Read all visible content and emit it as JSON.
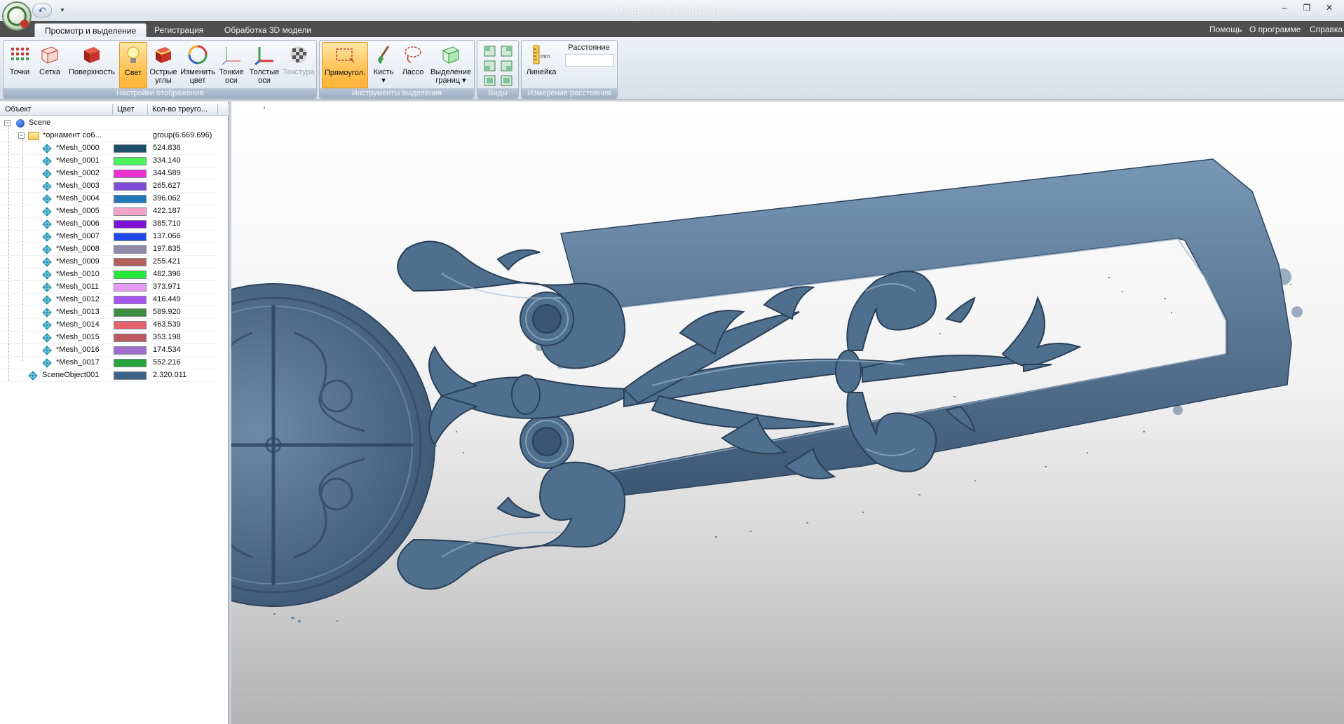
{
  "app": {
    "title": "RangeVision ScanMerge"
  },
  "quick_access": {
    "undo_glyph": "↶",
    "dropdown_glyph": "▾"
  },
  "window": {
    "minimize": "–",
    "restore": "❐",
    "close": "✕"
  },
  "tabs": [
    {
      "label": "Просмотр и выделение",
      "active": true
    },
    {
      "label": "Регистрация",
      "active": false
    },
    {
      "label": "Обработка 3D модели",
      "active": false
    }
  ],
  "help_links": [
    "Помощь",
    "О программе",
    "Справка"
  ],
  "ribbon": {
    "groups": [
      {
        "label": "Настройки отображения"
      },
      {
        "label": "Инструменты выделения"
      },
      {
        "label": "Виды"
      },
      {
        "label": "Измерение расстояния"
      }
    ],
    "display": {
      "points": "Точки",
      "grid": "Сетка",
      "surface": "Поверхность",
      "light": "Свет",
      "sharp_angles": [
        "Острые",
        "углы"
      ],
      "change_color": [
        "Изменить",
        "цвет"
      ],
      "thin_axes": [
        "Тонкие",
        "оси"
      ],
      "thick_axes": [
        "Толстые",
        "оси"
      ],
      "texture": "Текстура"
    },
    "selection": {
      "rectangle": "Прямоугол.",
      "brush": "Кисть",
      "lasso": "Лассо",
      "boundary": [
        "Выделение",
        "границ"
      ]
    },
    "measure": {
      "ruler": "Линейка",
      "ruler_unit": "mm",
      "distance_label": "Расстояние",
      "distance_value": ""
    }
  },
  "tree": {
    "headers": {
      "object": "Объект",
      "color": "Цвет",
      "triangles": "Кол-во треуго..."
    },
    "scene": "Scene",
    "group": {
      "name": "*орнамент соб...",
      "count": "group(6.669.696)"
    },
    "meshes": [
      {
        "name": "*Mesh_0000",
        "color": "#1d4f66",
        "count": "524.836"
      },
      {
        "name": "*Mesh_0001",
        "color": "#4bf25c",
        "count": "334.140"
      },
      {
        "name": "*Mesh_0002",
        "color": "#ee2fd2",
        "count": "344.589"
      },
      {
        "name": "*Mesh_0003",
        "color": "#7e4bd6",
        "count": "265.627"
      },
      {
        "name": "*Mesh_0004",
        "color": "#1f78b8",
        "count": "396.062"
      },
      {
        "name": "*Mesh_0005",
        "color": "#f3a4c6",
        "count": "422.187"
      },
      {
        "name": "*Mesh_0006",
        "color": "#7d10d4",
        "count": "385.710"
      },
      {
        "name": "*Mesh_0007",
        "color": "#1f49e8",
        "count": "137.066"
      },
      {
        "name": "*Mesh_0008",
        "color": "#8f8aa8",
        "count": "197.835"
      },
      {
        "name": "*Mesh_0009",
        "color": "#b5605c",
        "count": "255.421"
      },
      {
        "name": "*Mesh_0010",
        "color": "#25e83a",
        "count": "482.396"
      },
      {
        "name": "*Mesh_0011",
        "color": "#e79af1",
        "count": "373.971"
      },
      {
        "name": "*Mesh_0012",
        "color": "#a856ee",
        "count": "416.449"
      },
      {
        "name": "*Mesh_0013",
        "color": "#3a8e3e",
        "count": "589.920"
      },
      {
        "name": "*Mesh_0014",
        "color": "#e8626a",
        "count": "463.539"
      },
      {
        "name": "*Mesh_0015",
        "color": "#bd5a5f",
        "count": "353.198"
      },
      {
        "name": "*Mesh_0016",
        "color": "#a36ccf",
        "count": "174.534"
      },
      {
        "name": "*Mesh_0017",
        "color": "#29a63b",
        "count": "552.216"
      }
    ],
    "scene_object": {
      "name": "SceneObject001",
      "color": "#3f6487",
      "count": "2.320.011"
    }
  },
  "viewport": {
    "model_color": "#4f6f8e"
  }
}
